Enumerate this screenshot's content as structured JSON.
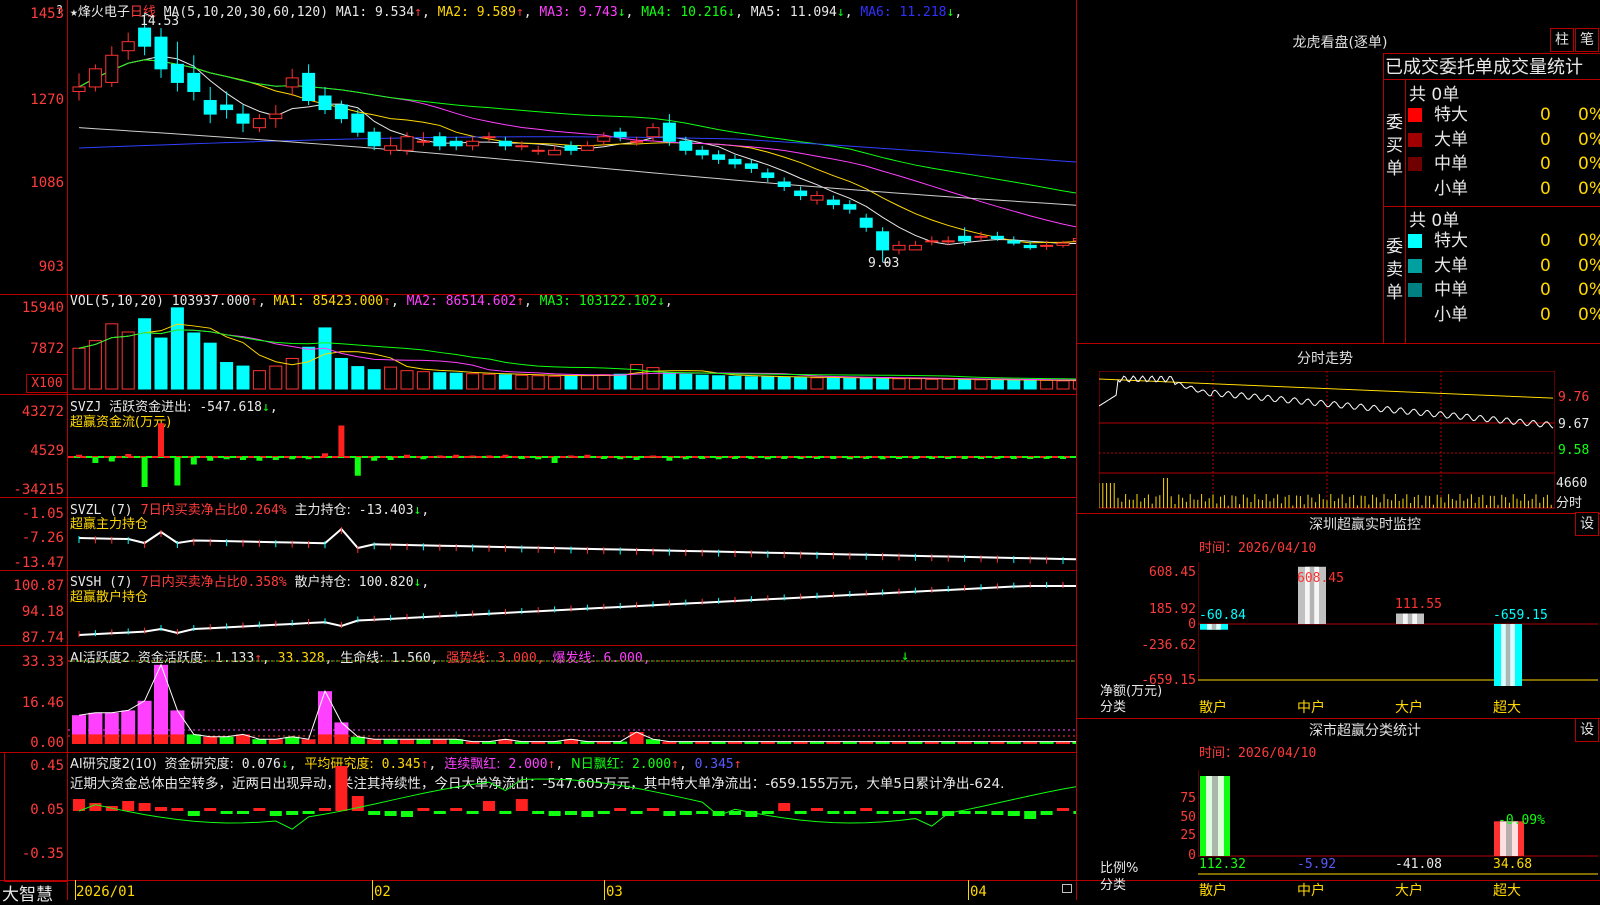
{
  "price_panel": {
    "star": "★",
    "stock_name": "烽火电子",
    "period": "日线",
    "ma_label": "MA(5,10,20,30,60,120)",
    "ma_values": [
      {
        "label": "MA1:",
        "value": "9.534",
        "arrow": "↑",
        "color": "#e8e8e8"
      },
      {
        "label": "MA2:",
        "value": "9.589",
        "arrow": "↑",
        "color": "#ffd800"
      },
      {
        "label": "MA3:",
        "value": "9.743",
        "arrow": "↓",
        "color": "#ff40ff"
      },
      {
        "label": "MA4:",
        "value": "10.216",
        "arrow": "↓",
        "color": "#10ff10"
      },
      {
        "label": "MA5:",
        "value": "11.094",
        "arrow": "↓",
        "color": "#e8e8e8"
      },
      {
        "label": "MA6:",
        "value": "11.218",
        "arrow": "↓",
        "color": "#3030ff"
      }
    ],
    "y_ticks": [
      "1453",
      "1270",
      "1086",
      "903"
    ],
    "high_mark": "14.53",
    "low_mark": "9.03",
    "corner_mark": "?"
  },
  "vol_panel": {
    "label": "VOL(5,10,20)",
    "value": "103937.000",
    "value_arrow": "↑",
    "ma": [
      {
        "label": "MA1:",
        "value": "85423.000",
        "arrow": "↑",
        "color": "#ffd800"
      },
      {
        "label": "MA2:",
        "value": "86514.602",
        "arrow": "↑",
        "color": "#ff40ff"
      },
      {
        "label": "MA3:",
        "value": "103122.102",
        "arrow": "↓",
        "color": "#10ff10"
      }
    ],
    "y_ticks": [
      "15940",
      "7872"
    ],
    "unit": "X100"
  },
  "svzj_panel": {
    "code": "SVZJ",
    "label": "活跃资金进出:",
    "value": "-547.618",
    "arrow": "↓",
    "subtitle": "超赢资金流(万元)",
    "y_ticks": [
      "43272",
      "4529",
      "-34215"
    ]
  },
  "svzl_panel": {
    "code": "SVZL",
    "param": "(7)",
    "ratio_label": "7日内买卖净占比",
    "ratio_value": "0.264%",
    "label": "主力持仓:",
    "value": "-13.403",
    "arrow": "↓",
    "subtitle": "超赢主力持仓",
    "y_ticks": [
      "-1.05",
      "-7.26",
      "-13.47"
    ]
  },
  "svsh_panel": {
    "code": "SVSH",
    "param": "(7)",
    "ratio_label": "7日内买卖净占比",
    "ratio_value": "0.358%",
    "label": "散户持仓:",
    "value": "100.820",
    "arrow": "↓",
    "subtitle": "超赢散户持仓",
    "y_ticks": [
      "100.87",
      "94.18",
      "87.74"
    ]
  },
  "ai_active_panel": {
    "title": "AI活跃度2",
    "label": "资金活跃度:",
    "value": "1.133",
    "arrow": "↑",
    "v2": "33.328",
    "life_label": "生命线:",
    "life_value": "1.560",
    "strong_label": "强势线:",
    "strong_value": "3.000",
    "burst_label": "爆发线:",
    "burst_value": "6.000",
    "y_ticks": [
      "33.33",
      "16.46",
      "0.00"
    ]
  },
  "ai_research_panel": {
    "title": "AI研究度2(10)",
    "label": "资金研究度:",
    "value": "0.076",
    "arrow": "↓",
    "avg_label": "平均研究度:",
    "avg_value": "0.345",
    "avg_arrow": "↑",
    "cont_label": "连续飘红:",
    "cont_value": "2.000",
    "cont_arrow": "↑",
    "n_label": "N日飘红:",
    "n_value": "2.000",
    "n_arrow": "↑",
    "last_value": "0.345",
    "last_arrow": "↑",
    "note": "近期大资金总体由空转多，近两日出现异动，关注其持续性，今日大单净流出：-547.605万元，其中特大单净流出：-659.155万元，大单5日累计净出-624.",
    "y_ticks": [
      "0.45",
      "0.05",
      "-0.35"
    ]
  },
  "bottom_bar": {
    "brand": "大智慧",
    "dates": [
      "2026/01",
      "02",
      "03",
      "04"
    ]
  },
  "longhu": {
    "title": "龙虎看盘(逐单)",
    "btn_zhu": "柱",
    "btn_bi": "笔",
    "tabs": "已成交委托单成交量统计",
    "buy_label": "委买单",
    "sell_label": "委卖单",
    "buy_total": "共 0单",
    "sell_total": "共 0单",
    "buy_rows": [
      {
        "label": "特大",
        "count": "0",
        "pct": "0%",
        "color": "#ff0000"
      },
      {
        "label": "大单",
        "count": "0",
        "pct": "0%",
        "color": "#a00000"
      },
      {
        "label": "中单",
        "count": "0",
        "pct": "0%",
        "color": "#700000"
      },
      {
        "label": "小单",
        "count": "0",
        "pct": "0%",
        "color": "#000000"
      }
    ],
    "sell_rows": [
      {
        "label": "特大",
        "count": "0",
        "pct": "0%",
        "color": "#00ffff"
      },
      {
        "label": "大单",
        "count": "0",
        "pct": "0%",
        "color": "#00a0a0"
      },
      {
        "label": "中单",
        "count": "0",
        "pct": "0%",
        "color": "#008080"
      },
      {
        "label": "小单",
        "count": "0",
        "pct": "0%",
        "color": "#000000"
      }
    ]
  },
  "intraday": {
    "title": "分时走势",
    "y_ticks": [
      "9.76",
      "9.67",
      "9.58"
    ],
    "vol_value": "4660",
    "vol_unit": "分时"
  },
  "sz_monitor": {
    "title": "深圳超赢实时监控",
    "btn": "设",
    "time_label": "时间：",
    "time_value": "2026/04/10",
    "y_ticks": [
      "608.45",
      "185.92",
      "0",
      "-236.62",
      "-659.15"
    ],
    "y_title": "净额(万元)",
    "x_title": "分类",
    "categories": [
      "散户",
      "中户",
      "大户",
      "超大"
    ],
    "values": [
      "-60.84",
      "608.45",
      "111.55",
      "-659.15"
    ]
  },
  "sz_class": {
    "title": "深市超赢分类统计",
    "btn": "设",
    "time_label": "时间：",
    "time_value": "2026/04/10",
    "y_ticks": [
      "75",
      "50",
      "25",
      "0"
    ],
    "y_title": "比例%",
    "x_title": "分类",
    "categories": [
      "散户",
      "中户",
      "大户",
      "超大"
    ],
    "values": [
      "112.32",
      "-5.92",
      "-41.08",
      "34.68"
    ],
    "top_label": "-0.09%"
  },
  "chart_data": [
    {
      "type": "candlestick",
      "title": "烽火电子 日线",
      "y_ticks": [
        14.53,
        12.7,
        10.86,
        9.03
      ],
      "high": 14.53,
      "low": 9.03,
      "candles": [
        [
          12.8,
          13.2,
          12.6,
          12.9
        ],
        [
          12.9,
          13.4,
          12.8,
          13.3
        ],
        [
          13.0,
          13.8,
          12.9,
          13.6
        ],
        [
          13.7,
          14.1,
          13.5,
          13.9
        ],
        [
          14.2,
          14.53,
          13.6,
          13.8
        ],
        [
          14.0,
          14.2,
          13.1,
          13.3
        ],
        [
          13.4,
          13.9,
          12.8,
          13.0
        ],
        [
          13.2,
          13.6,
          12.6,
          12.8
        ],
        [
          12.6,
          12.9,
          12.1,
          12.3
        ],
        [
          12.5,
          12.8,
          12.2,
          12.4
        ],
        [
          12.3,
          12.5,
          11.9,
          12.1
        ],
        [
          12.0,
          12.3,
          11.9,
          12.2
        ],
        [
          12.2,
          12.5,
          12.0,
          12.3
        ],
        [
          12.9,
          13.3,
          12.7,
          13.1
        ],
        [
          13.2,
          13.4,
          12.5,
          12.6
        ],
        [
          12.7,
          12.9,
          12.3,
          12.4
        ],
        [
          12.5,
          12.6,
          12.1,
          12.2
        ],
        [
          12.3,
          12.4,
          11.8,
          11.9
        ],
        [
          11.9,
          12.0,
          11.5,
          11.6
        ],
        [
          11.5,
          11.8,
          11.4,
          11.6
        ],
        [
          11.5,
          11.9,
          11.4,
          11.8
        ],
        [
          11.7,
          11.9,
          11.6,
          11.7
        ],
        [
          11.8,
          11.9,
          11.5,
          11.6
        ],
        [
          11.7,
          11.8,
          11.5,
          11.6
        ],
        [
          11.6,
          11.8,
          11.5,
          11.7
        ],
        [
          11.8,
          11.9,
          11.7,
          11.8
        ],
        [
          11.7,
          11.8,
          11.5,
          11.6
        ],
        [
          11.6,
          11.7,
          11.5,
          11.6
        ],
        [
          11.5,
          11.6,
          11.4,
          11.5
        ],
        [
          11.4,
          11.6,
          11.4,
          11.5
        ],
        [
          11.6,
          11.7,
          11.4,
          11.5
        ],
        [
          11.5,
          11.7,
          11.5,
          11.6
        ],
        [
          11.7,
          11.9,
          11.6,
          11.8
        ],
        [
          11.9,
          12.0,
          11.7,
          11.8
        ],
        [
          11.7,
          11.8,
          11.6,
          11.7
        ],
        [
          11.8,
          12.1,
          11.7,
          12.0
        ],
        [
          12.1,
          12.3,
          11.6,
          11.7
        ],
        [
          11.7,
          11.8,
          11.4,
          11.5
        ],
        [
          11.5,
          11.6,
          11.3,
          11.4
        ],
        [
          11.4,
          11.5,
          11.2,
          11.3
        ],
        [
          11.3,
          11.4,
          11.1,
          11.2
        ],
        [
          11.2,
          11.3,
          11.0,
          11.1
        ],
        [
          11.0,
          11.1,
          10.8,
          10.9
        ],
        [
          10.8,
          10.9,
          10.6,
          10.7
        ],
        [
          10.6,
          10.7,
          10.4,
          10.5
        ],
        [
          10.4,
          10.6,
          10.3,
          10.5
        ],
        [
          10.4,
          10.5,
          10.2,
          10.3
        ],
        [
          10.3,
          10.4,
          10.1,
          10.2
        ],
        [
          10.0,
          10.1,
          9.7,
          9.8
        ],
        [
          9.7,
          9.8,
          9.03,
          9.3
        ],
        [
          9.3,
          9.5,
          9.2,
          9.4
        ],
        [
          9.3,
          9.5,
          9.3,
          9.4
        ],
        [
          9.5,
          9.6,
          9.4,
          9.5
        ],
        [
          9.5,
          9.6,
          9.4,
          9.5
        ],
        [
          9.6,
          9.8,
          9.4,
          9.5
        ],
        [
          9.6,
          9.7,
          9.5,
          9.6
        ],
        [
          9.6,
          9.7,
          9.5,
          9.55
        ],
        [
          9.5,
          9.6,
          9.4,
          9.45
        ],
        [
          9.4,
          9.5,
          9.3,
          9.35
        ],
        [
          9.4,
          9.5,
          9.3,
          9.4
        ],
        [
          9.4,
          9.5,
          9.35,
          9.45
        ],
        [
          9.5,
          9.6,
          9.4,
          9.55
        ],
        [
          9.5,
          9.6,
          9.45,
          9.55
        ],
        [
          9.5,
          9.6,
          9.45,
          9.534
        ]
      ]
    },
    {
      "type": "bar",
      "title": "VOL(5,10,20)",
      "y_ticks": [
        15940,
        7872
      ],
      "values": [
        8000,
        9500,
        12800,
        11200,
        13800,
        10000,
        15940,
        11000,
        9000,
        5200,
        4500,
        3600,
        4500,
        6000,
        8200,
        12000,
        6000,
        4400,
        3800,
        4300,
        3600,
        3400,
        3200,
        3100,
        3000,
        2900,
        2800,
        2700,
        2600,
        2500,
        2600,
        2700,
        2800,
        2900,
        4800,
        4200,
        3200,
        2900,
        2700,
        2600,
        2500,
        2400,
        2400,
        2300,
        2300,
        2200,
        2200,
        2100,
        2200,
        2100,
        2000,
        2000,
        1900,
        1900,
        1800,
        1800,
        1800,
        1700,
        1700,
        1700,
        1600,
        1600,
        1700,
        1800
      ]
    }
  ]
}
